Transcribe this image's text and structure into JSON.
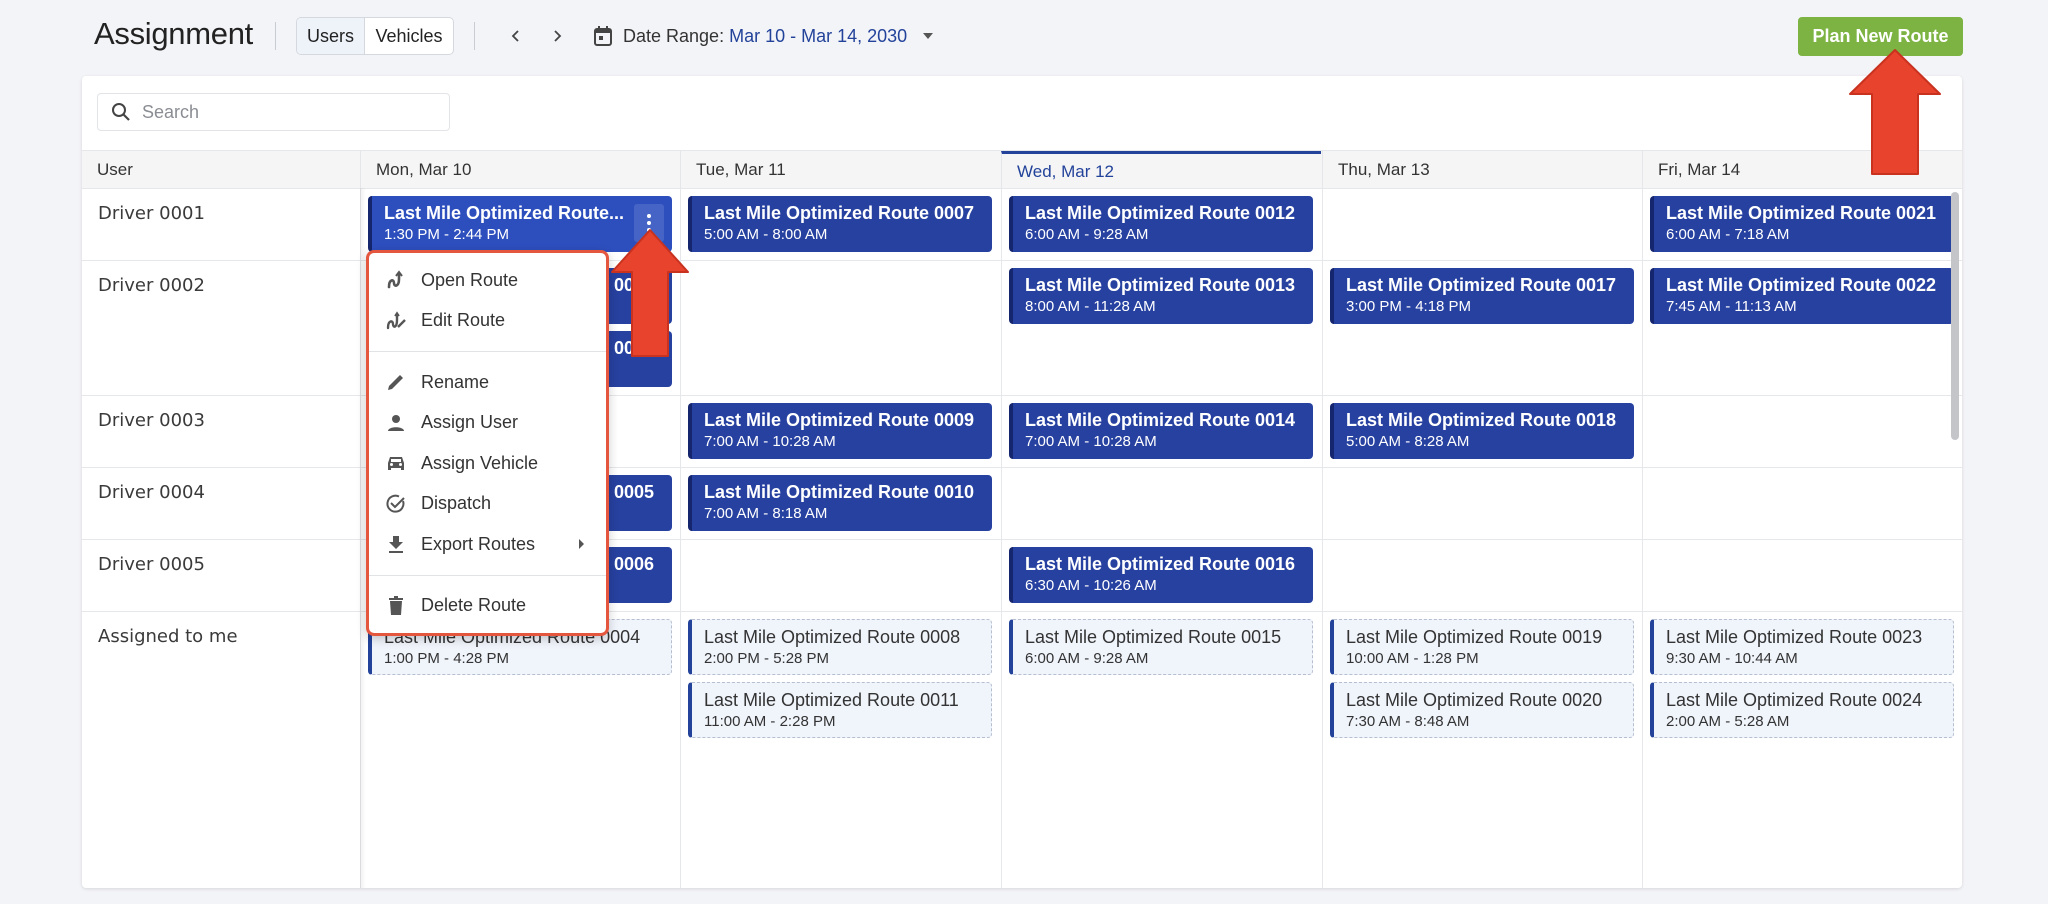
{
  "header": {
    "title": "Assignment",
    "toggle": {
      "users_label": "Users",
      "vehicles_label": "Vehicles",
      "active": "Users"
    },
    "prev_icon": "chevron-left-icon",
    "next_icon": "chevron-right-icon",
    "date_range_label": "Date Range:",
    "date_range_value": "Mar 10 - Mar 14, 2030",
    "plan_button_label": "Plan New Route"
  },
  "search": {
    "placeholder": "Search",
    "value": ""
  },
  "grid": {
    "user_header": "User",
    "days": [
      {
        "label": "Mon, Mar 10",
        "today": false
      },
      {
        "label": "Tue, Mar 11",
        "today": false
      },
      {
        "label": "Wed, Mar 12",
        "today": true
      },
      {
        "label": "Thu, Mar 13",
        "today": false
      },
      {
        "label": "Fri, Mar 14",
        "today": false
      }
    ],
    "rows": [
      {
        "label": "Driver 0001"
      },
      {
        "label": "Driver 0002"
      },
      {
        "label": "Driver 0003"
      },
      {
        "label": "Driver 0004"
      },
      {
        "label": "Driver 0005"
      },
      {
        "label": "Assigned to me"
      }
    ],
    "routes": [
      {
        "row": 0,
        "day": 0,
        "slot": 0,
        "name": "Last Mile Optimized Route...",
        "time": "1:30 PM - 2:44 PM",
        "style": "solid",
        "active": true
      },
      {
        "row": 0,
        "day": 1,
        "slot": 0,
        "name": "Last Mile Optimized Route 0007",
        "time": "5:00 AM - 8:00 AM",
        "style": "solid"
      },
      {
        "row": 0,
        "day": 2,
        "slot": 0,
        "name": "Last Mile Optimized Route 0012",
        "time": "6:00 AM - 9:28 AM",
        "style": "solid"
      },
      {
        "row": 0,
        "day": 4,
        "slot": 0,
        "name": "Last Mile Optimized Route 0021",
        "time": "6:00 AM - 7:18 AM",
        "style": "solid"
      },
      {
        "row": 1,
        "day": 0,
        "slot": 0,
        "name": "Last Mile Optimized Route 0002",
        "time": "",
        "style": "solid"
      },
      {
        "row": 1,
        "day": 0,
        "slot": 1,
        "name": "Last Mile Optimized Route 0003",
        "time": "",
        "style": "solid"
      },
      {
        "row": 1,
        "day": 2,
        "slot": 0,
        "name": "Last Mile Optimized Route 0013",
        "time": "8:00 AM - 11:28 AM",
        "style": "solid"
      },
      {
        "row": 1,
        "day": 3,
        "slot": 0,
        "name": "Last Mile Optimized Route 0017",
        "time": "3:00 PM - 4:18 PM",
        "style": "solid"
      },
      {
        "row": 1,
        "day": 4,
        "slot": 0,
        "name": "Last Mile Optimized Route 0022",
        "time": "7:45 AM - 11:13 AM",
        "style": "solid"
      },
      {
        "row": 2,
        "day": 1,
        "slot": 0,
        "name": "Last Mile Optimized Route 0009",
        "time": "7:00 AM - 10:28 AM",
        "style": "solid"
      },
      {
        "row": 2,
        "day": 2,
        "slot": 0,
        "name": "Last Mile Optimized Route 0014",
        "time": "7:00 AM - 10:28 AM",
        "style": "solid"
      },
      {
        "row": 2,
        "day": 3,
        "slot": 0,
        "name": "Last Mile Optimized Route 0018",
        "time": "5:00 AM - 8:28 AM",
        "style": "solid"
      },
      {
        "row": 3,
        "day": 0,
        "slot": 0,
        "name": "Last Mile Optimized Route 0005",
        "time": "",
        "style": "solid"
      },
      {
        "row": 3,
        "day": 1,
        "slot": 0,
        "name": "Last Mile Optimized Route 0010",
        "time": "7:00 AM - 8:18 AM",
        "style": "solid"
      },
      {
        "row": 4,
        "day": 0,
        "slot": 0,
        "name": "Last Mile Optimized Route 0006",
        "time": "",
        "style": "solid"
      },
      {
        "row": 4,
        "day": 2,
        "slot": 0,
        "name": "Last Mile Optimized Route 0016",
        "time": "6:30 AM - 10:26 AM",
        "style": "solid"
      },
      {
        "row": 5,
        "day": 0,
        "slot": 0,
        "name": "Last Mile Optimized Route 0004",
        "time": "1:00 PM - 4:28 PM",
        "style": "dashed"
      },
      {
        "row": 5,
        "day": 1,
        "slot": 0,
        "name": "Last Mile Optimized Route 0008",
        "time": "2:00 PM - 5:28 PM",
        "style": "dashed"
      },
      {
        "row": 5,
        "day": 1,
        "slot": 1,
        "name": "Last Mile Optimized Route 0011",
        "time": "11:00 AM - 2:28 PM",
        "style": "dashed"
      },
      {
        "row": 5,
        "day": 2,
        "slot": 0,
        "name": "Last Mile Optimized Route 0015",
        "time": "6:00 AM - 9:28 AM",
        "style": "dashed"
      },
      {
        "row": 5,
        "day": 3,
        "slot": 0,
        "name": "Last Mile Optimized Route 0019",
        "time": "10:00 AM - 1:28 PM",
        "style": "dashed"
      },
      {
        "row": 5,
        "day": 3,
        "slot": 1,
        "name": "Last Mile Optimized Route 0020",
        "time": "7:30 AM - 8:48 AM",
        "style": "dashed"
      },
      {
        "row": 5,
        "day": 4,
        "slot": 0,
        "name": "Last Mile Optimized Route 0023",
        "time": "9:30 AM - 10:44 AM",
        "style": "dashed"
      },
      {
        "row": 5,
        "day": 4,
        "slot": 1,
        "name": "Last Mile Optimized Route 0024",
        "time": "2:00 AM - 5:28 AM",
        "style": "dashed"
      }
    ]
  },
  "context_menu": {
    "groups": [
      [
        {
          "label": "Open Route",
          "icon": "route-icon"
        },
        {
          "label": "Edit Route",
          "icon": "edit-route-icon"
        }
      ],
      [
        {
          "label": "Rename",
          "icon": "pencil-icon"
        },
        {
          "label": "Assign User",
          "icon": "person-icon"
        },
        {
          "label": "Assign Vehicle",
          "icon": "car-icon"
        },
        {
          "label": "Dispatch",
          "icon": "check-circle-icon"
        },
        {
          "label": "Export Routes",
          "icon": "download-icon",
          "submenu": true
        }
      ],
      [
        {
          "label": "Delete Route",
          "icon": "trash-icon"
        }
      ]
    ]
  },
  "colors": {
    "primary": "#23439a",
    "card_solid": "#2741a0",
    "card_active": "#2d4fbe",
    "plan_button": "#7cb342",
    "annotation_red": "#e4563d"
  }
}
